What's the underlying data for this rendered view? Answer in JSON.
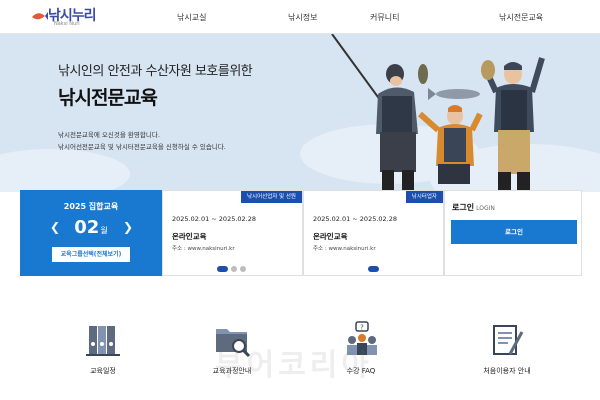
{
  "brand": {
    "logo_text": "낚시누리",
    "logo_sub": "Naksi Nuri"
  },
  "nav": [
    {
      "label": "낚시교실"
    },
    {
      "label": "낚시정보"
    },
    {
      "label": "커뮤니티"
    },
    {
      "label": "낚시전문교육"
    }
  ],
  "hero": {
    "subtitle": "낚시인의 안전과 수산자원 보호를위한",
    "title": "낚시전문교육",
    "desc_line1": "낚시전문교육에 오신것을 환영합니다.",
    "desc_line2": "낚시어선전문교육 및 낚시터전문교육을 신청하실 수 있습니다."
  },
  "schedule": {
    "title": "2025 집합교육",
    "month": "02",
    "month_unit": "월",
    "prev_icon": "chevron-left-icon",
    "next_icon": "chevron-right-icon",
    "select_button": "교육그룹선택(전체보기)"
  },
  "edu_cards": [
    {
      "tag": "낚시어선업자 및 선원",
      "date": "2025.02.01 ~ 2025.02.28",
      "name": "온라인교육",
      "address": "주소 : www.naksinuri.kr"
    },
    {
      "tag": "낚시터업자",
      "date": "2025.02.01 ~ 2025.02.28",
      "name": "온라인교육",
      "address": "주소 : www.naksinuri.kr"
    }
  ],
  "login": {
    "title": "로그인",
    "title_en": "LOGIN",
    "button": "로그인"
  },
  "quick_links": [
    {
      "label": "교육일정",
      "icon": "binders-icon"
    },
    {
      "label": "교육과정안내",
      "icon": "folder-search-icon"
    },
    {
      "label": "수강 FAQ",
      "icon": "faq-people-icon"
    },
    {
      "label": "처음이용자 안내",
      "icon": "document-pen-icon"
    }
  ],
  "watermark": "부어코리아",
  "colors": {
    "primary": "#1978d0",
    "navy": "#1b4fae",
    "hero_bg": "#d7e4f2"
  }
}
